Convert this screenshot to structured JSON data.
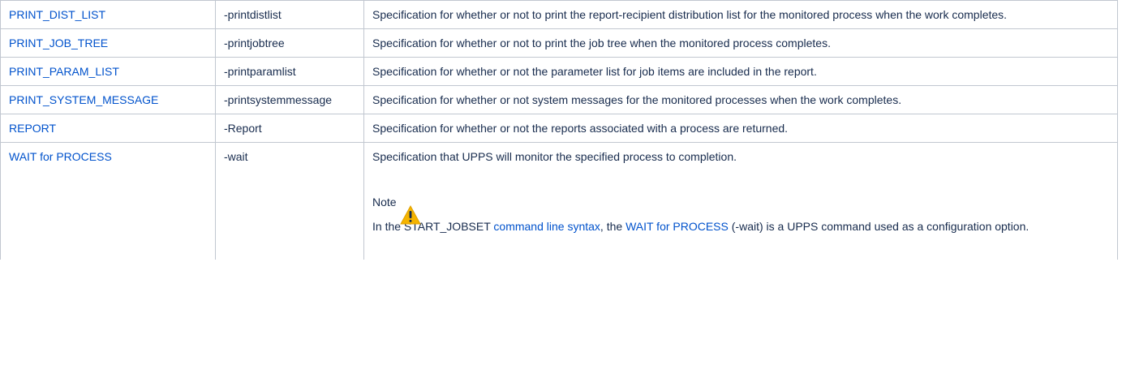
{
  "rows": [
    {
      "name": "PRINT_DIST_LIST",
      "flag": "-printdistlist",
      "description": "Specification for whether or not to print the report-recipient distribution list for the monitored process when the work completes."
    },
    {
      "name": "PRINT_JOB_TREE",
      "flag": "-printjobtree",
      "description": "Specification for whether or not to print the job tree when the monitored process completes."
    },
    {
      "name": "PRINT_PARAM_LIST",
      "flag": "-printparamlist",
      "description": "Specification for whether or not the parameter list for job items are included in the report."
    },
    {
      "name": "PRINT_SYSTEM_MESSAGE",
      "flag": "-printsystemmessage",
      "description": "Specification for whether or not system messages for the monitored processes when the work completes."
    },
    {
      "name": "REPORT",
      "flag": "-Report",
      "description": "Specification for whether or not the reports associated with a process are returned."
    },
    {
      "name": "WAIT for PROCESS",
      "flag": "-wait",
      "description": "Specification that UPPS will monitor the specified process to completion."
    }
  ],
  "note": {
    "title": "Note",
    "icon": "warning-icon",
    "text_before": "In the START_JOBSET ",
    "link1": "command line syntax",
    "text_middle": ", the ",
    "link2": "WAIT for PROCESS",
    "text_after": " (-wait) is a UPPS command used as a configuration option."
  },
  "colors": {
    "link": "#0052cc",
    "border": "#c1c7d0",
    "warning": "#f5b400"
  }
}
